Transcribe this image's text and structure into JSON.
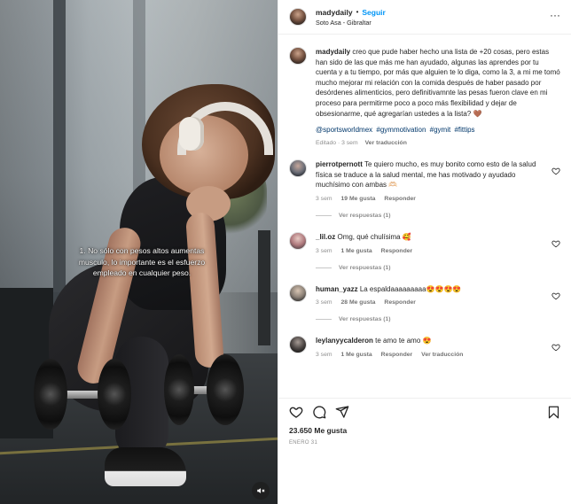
{
  "media": {
    "caption_text": "1. No sólo con pesos altos aumentas\nmusculo, lo importante es el esfuerzo\nempleado en cualquier peso."
  },
  "header": {
    "username": "madydaily",
    "separator": "•",
    "follow_label": "Seguir",
    "location": "Soto Asa - Gibraltar",
    "more_label": "···"
  },
  "post": {
    "username": "madydaily",
    "text": "creo que pude haber hecho una lista de +20 cosas, pero estas han sido de las que más me han ayudado, algunas las aprendes por tu cuenta y a tu tiempo, por más que alguien te lo diga, como la 3, a mi me tomó mucho mejorar mi relación con la comida después de haber pasado por desórdenes alimenticios, pero definitivamnte las pesas fueron clave en mi proceso para permitirme poco a poco más flexibilidad y dejar de obsesionarme, qué agregarían ustedes a la lista? 🤎",
    "hashtags": [
      "@sportsworldmex",
      "#gymmotivation",
      "#gymit",
      "#fittips"
    ],
    "edited_label": "Editado",
    "separator": "·",
    "time": "3 sem",
    "translate_label": "Ver traducción"
  },
  "comments": [
    {
      "username": "pierrotpernott",
      "text": "Te quiero mucho, es muy bonito como esto de la salud física se traduce a la salud mental, me has motivado y ayudado muchísimo con ambas 🫶🏻",
      "time": "3 sem",
      "likes": "19 Me gusta",
      "reply_label": "Responder",
      "translate_label": "",
      "replies_label": "Ver respuestas (1)"
    },
    {
      "username": "_lil.oz",
      "text": "Omg, qué chulísima 🥰",
      "time": "3 sem",
      "likes": "1 Me gusta",
      "reply_label": "Responder",
      "translate_label": "",
      "replies_label": "Ver respuestas (1)"
    },
    {
      "username": "human_yazz",
      "text": "La espaldaaaaaaaaa😍😍😍😍",
      "time": "3 sem",
      "likes": "28 Me gusta",
      "reply_label": "Responder",
      "translate_label": "",
      "replies_label": "Ver respuestas (1)"
    },
    {
      "username": "leylanyycalderon",
      "text": "te amo te amo 😍",
      "time": "3 sem",
      "likes": "1 Me gusta",
      "reply_label": "Responder",
      "translate_label": "Ver traducción",
      "replies_label": ""
    }
  ],
  "footer": {
    "likes": "23.650 Me gusta",
    "date": "ENERO 31"
  },
  "icons": {
    "like": "heart-icon",
    "comment": "comment-icon",
    "share": "share-icon",
    "save": "bookmark-icon",
    "mute": "mute-icon"
  },
  "colors": {
    "follow": "#0095f6",
    "text": "#262626",
    "secondary": "#8e8e8e",
    "hashtag": "#00376b"
  }
}
